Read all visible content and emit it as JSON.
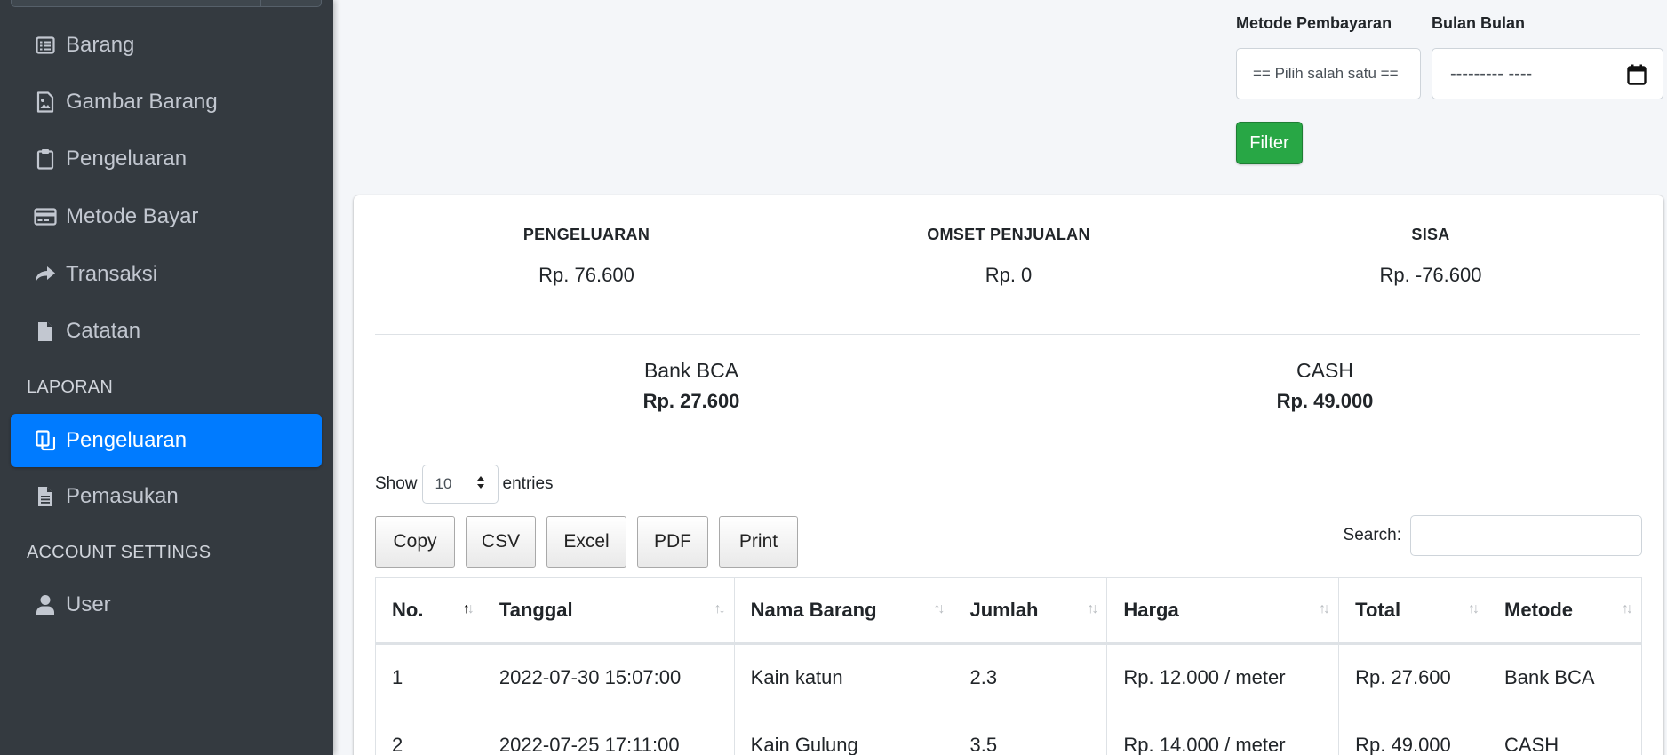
{
  "sidebar": {
    "items": [
      {
        "label": "Barang",
        "icon": "list-alt-icon"
      },
      {
        "label": "Gambar Barang",
        "icon": "file-image-icon"
      },
      {
        "label": "Pengeluaran",
        "icon": "clipboard-icon"
      },
      {
        "label": "Metode Bayar",
        "icon": "credit-card-icon"
      },
      {
        "label": "Transaksi",
        "icon": "share-icon"
      },
      {
        "label": "Catatan",
        "icon": "file-icon"
      }
    ],
    "header_laporan": "LAPORAN",
    "laporan_items": [
      {
        "label": "Pengeluaran",
        "icon": "copy-icon",
        "active": true
      },
      {
        "label": "Pemasukan",
        "icon": "file-alt-icon"
      }
    ],
    "header_account": "ACCOUNT SETTINGS",
    "account_items": [
      {
        "label": "User",
        "icon": "user-icon"
      }
    ]
  },
  "filter": {
    "metode_label": "Metode Pembayaran",
    "metode_value": "== Pilih salah satu ==",
    "bulan_label": "Bulan Bulan",
    "bulan_value": "---------  ----",
    "button": "Filter"
  },
  "summary": {
    "pengeluaran_title": "PENGELUARAN",
    "pengeluaran_value": "Rp. 76.600",
    "omset_title": "OMSET PENJUALAN",
    "omset_value": "Rp. 0",
    "sisa_title": "SISA",
    "sisa_value": "Rp. -76.600"
  },
  "methods": [
    {
      "name": "Bank BCA",
      "amount": "Rp. 27.600"
    },
    {
      "name": "CASH",
      "amount": "Rp. 49.000"
    }
  ],
  "datatable": {
    "show_label": "Show",
    "length_value": "10",
    "entries_label": "entries",
    "buttons": [
      "Copy",
      "CSV",
      "Excel",
      "PDF",
      "Print"
    ],
    "search_label": "Search:",
    "columns": [
      "No.",
      "Tanggal",
      "Nama Barang",
      "Jumlah",
      "Harga",
      "Total",
      "Metode"
    ],
    "rows": [
      [
        "1",
        "2022-07-30 15:07:00",
        "Kain katun",
        "2.3",
        "Rp. 12.000 / meter",
        "Rp. 27.600",
        "Bank BCA"
      ],
      [
        "2",
        "2022-07-25 17:11:00",
        "Kain Gulung",
        "3.5",
        "Rp. 14.000 / meter",
        "Rp. 49.000",
        "CASH"
      ]
    ]
  },
  "colors": {
    "sidebar_bg": "#343a40",
    "active": "#007bff",
    "filter_button": "#28a745",
    "page_bg": "#f4f6f9"
  }
}
